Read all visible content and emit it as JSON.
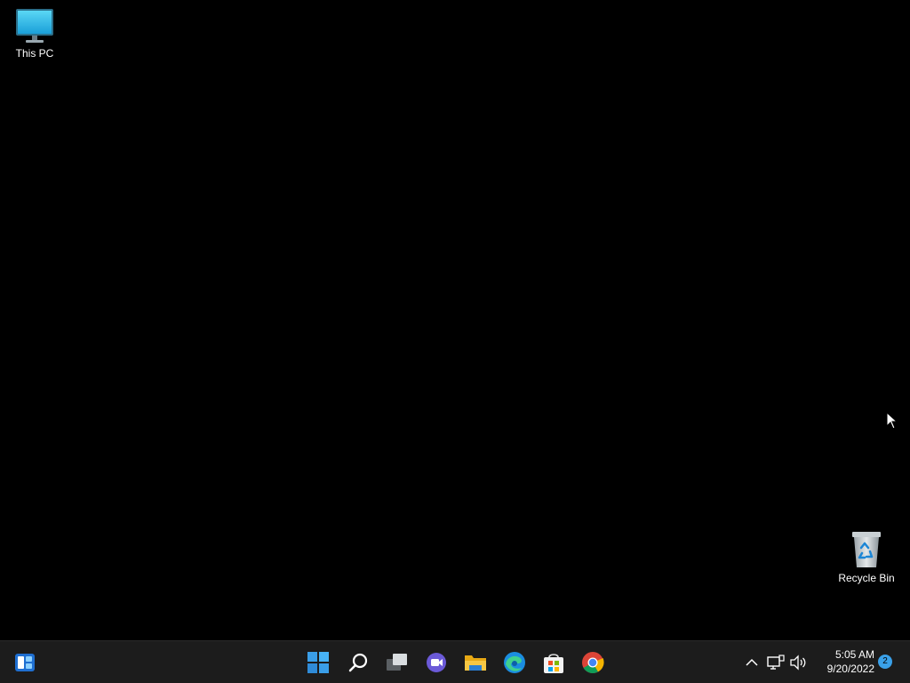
{
  "desktop": {
    "icons": [
      {
        "label": "This PC",
        "icon": "monitor-icon"
      },
      {
        "label": "Recycle Bin",
        "icon": "recycle-bin-icon"
      }
    ]
  },
  "taskbar": {
    "widgets": {
      "icon": "widgets-icon"
    },
    "center_apps": [
      {
        "name": "Start",
        "icon": "windows-start-icon"
      },
      {
        "name": "Search",
        "icon": "search-icon"
      },
      {
        "name": "Task View",
        "icon": "task-view-icon"
      },
      {
        "name": "Chat",
        "icon": "teams-chat-icon"
      },
      {
        "name": "File Explorer",
        "icon": "folder-icon"
      },
      {
        "name": "Microsoft Edge",
        "icon": "edge-icon"
      },
      {
        "name": "Microsoft Store",
        "icon": "store-icon"
      },
      {
        "name": "Google Chrome",
        "icon": "chrome-icon"
      }
    ],
    "tray": {
      "overflow_icon": "chevron-up-icon",
      "network_icon": "network-icon",
      "volume_icon": "volume-icon",
      "time": "5:05 AM",
      "date": "9/20/2022",
      "notification_count": "2"
    }
  },
  "colors": {
    "desktop_bg": "#000000",
    "taskbar_bg": "#1c1c1c",
    "accent": "#3aa0e8"
  }
}
